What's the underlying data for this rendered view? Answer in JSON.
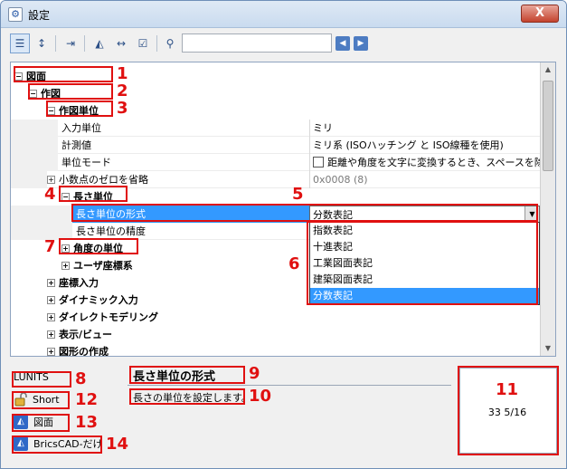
{
  "window": {
    "title": "設定",
    "close_label": "X"
  },
  "toolbar": {
    "search_value": "",
    "buttons": [
      "list-view-icon",
      "sort-az-icon",
      "export-icon",
      "bricscad-icon",
      "dimension-icon",
      "checklist-icon",
      "binoculars-icon"
    ]
  },
  "tree": {
    "rows": [
      {
        "name": "図面",
        "expander": "⊟",
        "bold": true
      },
      {
        "name": "作図",
        "expander": "⊟",
        "bold": true
      },
      {
        "name": "作図単位",
        "expander": "⊟",
        "bold": true
      },
      {
        "name": "入力単位",
        "value": "ミリ"
      },
      {
        "name": "計測値",
        "value": "ミリ系 (ISOハッチング と ISO線種を使用)"
      },
      {
        "name": "単位モード",
        "value": "距離や角度を文字に変換するとき、スペースを除外"
      },
      {
        "name": "小数点のゼロを省略",
        "expander": "⊞",
        "value": "0x0008 (8)"
      },
      {
        "name": "長さ単位",
        "expander": "⊟",
        "bold": true
      },
      {
        "name": "長さ単位の形式",
        "value": "分数表記"
      },
      {
        "name": "長さ単位の精度"
      },
      {
        "name": "角度の単位",
        "expander": "⊞",
        "bold": true
      },
      {
        "name": "ユーザ座標系",
        "expander": "⊞",
        "bold": true
      },
      {
        "name": "座標入力",
        "expander": "⊞",
        "bold": true
      },
      {
        "name": "ダイナミック入力",
        "expander": "⊞",
        "bold": true
      },
      {
        "name": "ダイレクトモデリング",
        "expander": "⊞",
        "bold": true
      },
      {
        "name": "表示/ビュー",
        "expander": "⊞",
        "bold": true
      },
      {
        "name": "図形の作成",
        "expander": "⊞",
        "bold": true
      }
    ],
    "dropdown_options": [
      "指数表記",
      "十進表記",
      "工業図面表記",
      "建築図面表記",
      "分数表記"
    ],
    "dropdown_selected_index": 4
  },
  "status": {
    "sysvar": "LUNITS",
    "lock_label": "Short",
    "scope_label": "図面",
    "product_label": "BricsCAD-だけ"
  },
  "property": {
    "title": "長さ単位の形式",
    "description": "長さの単位を設定します。"
  },
  "preview": {
    "value": "33 5/16"
  },
  "annotations": [
    "1",
    "2",
    "3",
    "4",
    "5",
    "6",
    "7",
    "8",
    "9",
    "10",
    "11",
    "12",
    "13",
    "14"
  ]
}
